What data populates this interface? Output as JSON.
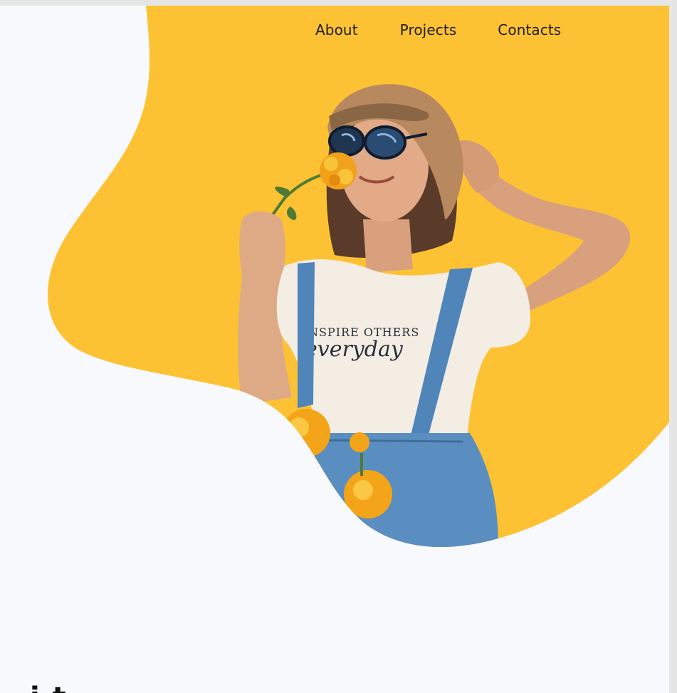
{
  "nav": {
    "items": [
      {
        "label": "About"
      },
      {
        "label": "Projects"
      },
      {
        "label": "Contacts"
      }
    ]
  },
  "hero": {
    "image_subject": "woman in straw hat and sunglasses smelling a marigold flower",
    "shirt_text_line1": "NSPIRE OTHERS",
    "shirt_text_line2": "everyday",
    "partial_heading": "i t"
  },
  "colors": {
    "accent": "#fdc233",
    "page_bg": "#f8f9fd",
    "text": "#1e1e1e"
  }
}
